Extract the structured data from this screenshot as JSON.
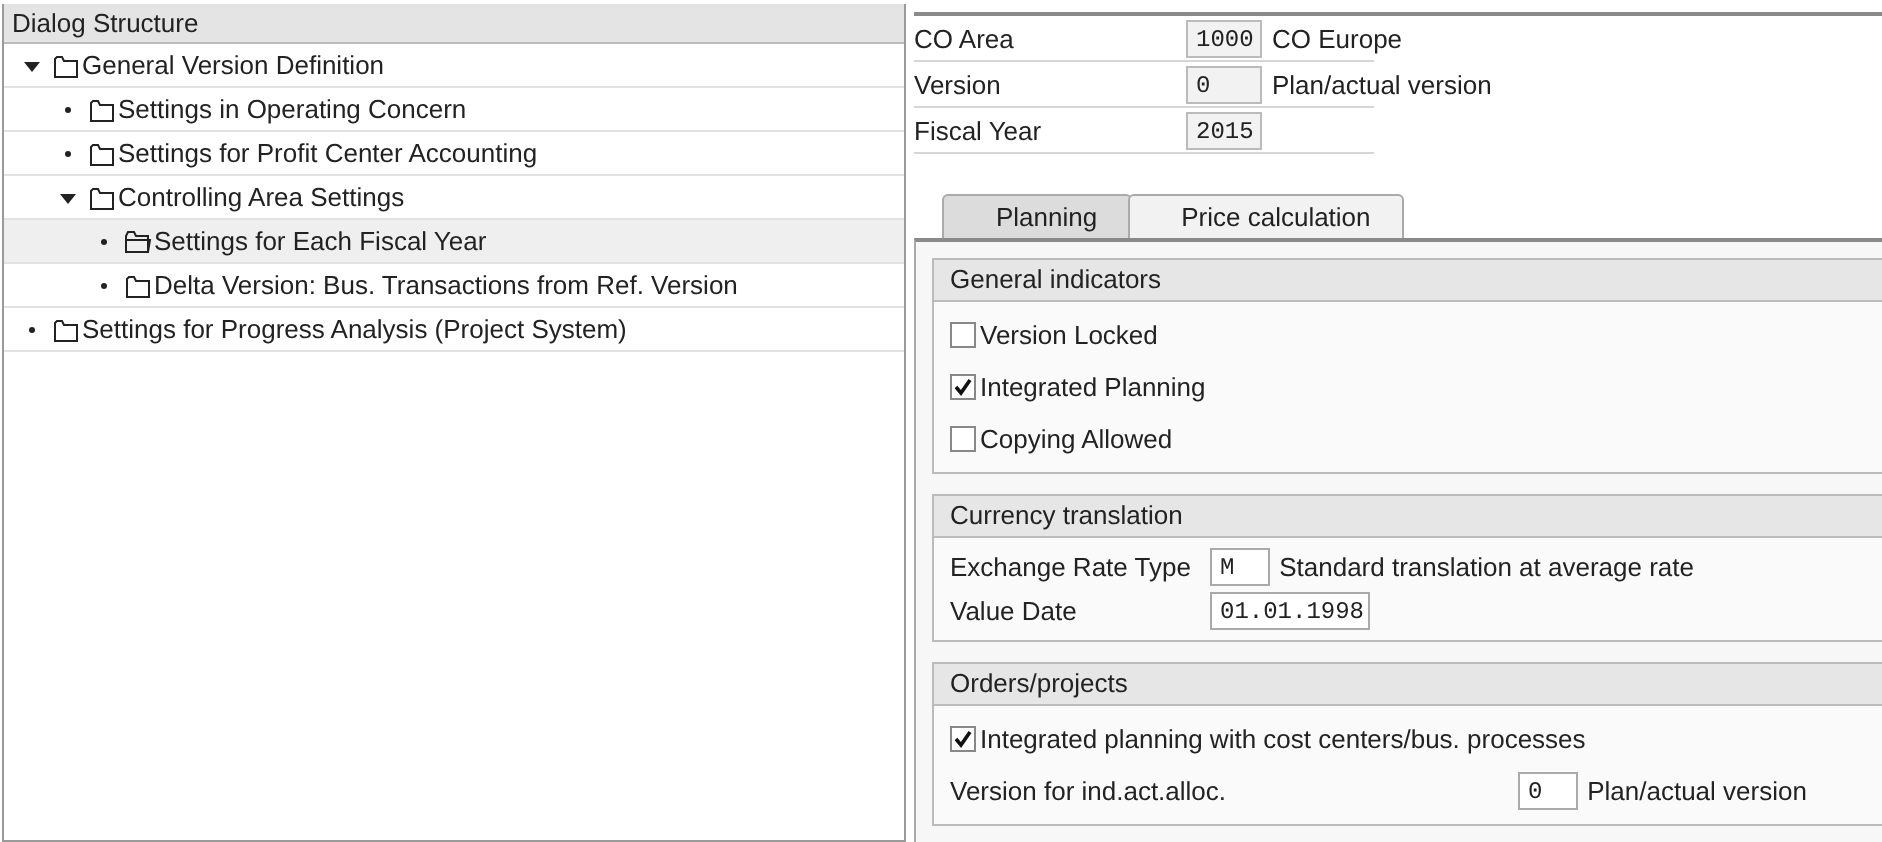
{
  "dialog_structure": {
    "title": "Dialog Structure",
    "items": [
      {
        "label": "General Version Definition",
        "expanded": true,
        "selected": false,
        "children": [
          {
            "label": "Settings in Operating Concern",
            "selected": false
          },
          {
            "label": "Settings for Profit Center Accounting",
            "selected": false
          },
          {
            "label": "Controlling Area Settings",
            "expanded": true,
            "selected": false,
            "children": [
              {
                "label": "Settings for Each Fiscal Year",
                "selected": true
              },
              {
                "label": "Delta Version: Bus. Transactions from Ref. Version",
                "selected": false
              }
            ]
          }
        ]
      },
      {
        "label": "Settings for Progress Analysis (Project System)",
        "selected": false
      }
    ]
  },
  "header_fields": [
    {
      "label": "CO Area",
      "value": "1000",
      "description": "CO Europe",
      "editable": false
    },
    {
      "label": "Version",
      "value": "0",
      "description": "Plan/actual version",
      "editable": false
    },
    {
      "label": "Fiscal Year",
      "value": "2015",
      "editable": false
    }
  ],
  "tabs": [
    {
      "label": "Planning",
      "selected": true
    },
    {
      "label": "Price calculation",
      "selected": false
    }
  ],
  "groups": [
    {
      "title": "General indicators",
      "rows": [
        {
          "kind": "checkbox",
          "label": "Version Locked",
          "checked": false
        },
        {
          "kind": "checkbox",
          "label": "Integrated Planning",
          "checked": true
        },
        {
          "kind": "checkbox",
          "label": "Copying Allowed",
          "checked": false
        }
      ]
    },
    {
      "title": "Currency translation",
      "rows": [
        {
          "kind": "field",
          "label": "Exchange Rate Type",
          "value": "M",
          "description": "Standard translation at average rate",
          "editable": true
        },
        {
          "kind": "field",
          "label": "Value Date",
          "value": "01.01.1998",
          "editable": true
        }
      ]
    },
    {
      "title": "Orders/projects",
      "rows": [
        {
          "kind": "checkbox",
          "label": "Integrated planning with cost centers/bus. processes",
          "checked": true
        },
        {
          "kind": "field",
          "label": "Version for ind.act.alloc.",
          "value": "0",
          "description": "Plan/actual version",
          "editable": true
        }
      ]
    }
  ]
}
